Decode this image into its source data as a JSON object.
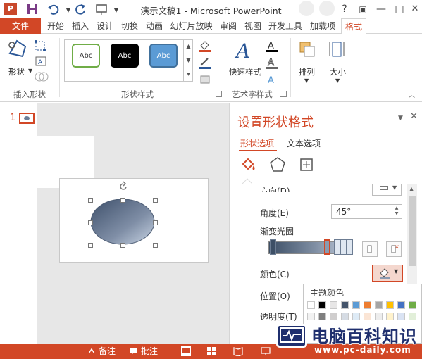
{
  "app": {
    "title": "演示文稿1 - Microsoft PowerPoint",
    "logo_letter": "P"
  },
  "win_controls": {
    "help": "?",
    "restore": "▣",
    "minimize": "—",
    "maximize": "□"
  },
  "tabs": {
    "file": "文件",
    "items": [
      "开始",
      "插入",
      "设计",
      "切换",
      "动画",
      "幻灯片放映",
      "审阅",
      "视图",
      "开发工具",
      "加载项"
    ],
    "active": "格式"
  },
  "ribbon": {
    "insert_shape": {
      "shape_label": "形状",
      "group_label": "插入形状"
    },
    "shape_styles": {
      "group_label": "形状样式",
      "presets": [
        {
          "label": "Abc",
          "fill": "#ffffff",
          "border": "#70ad47",
          "text": "#333333"
        },
        {
          "label": "Abc",
          "fill": "#000000",
          "border": "#000000",
          "text": "#ffffff"
        },
        {
          "label": "Abc",
          "fill": "#5b9bd5",
          "border": "#41719c",
          "text": "#ffffff"
        }
      ]
    },
    "art_styles": {
      "quick_styles_label": "快速样式",
      "group_label": "艺术字样式"
    },
    "arrange": {
      "label": "排列"
    },
    "size": {
      "label": "大小"
    }
  },
  "slides": {
    "number": "1"
  },
  "format_pane": {
    "title": "设置形状格式",
    "tabs": {
      "shape_options": "形状选项",
      "text_options": "文本选项"
    },
    "direction_label": "方向(D)",
    "angle_label": "角度(E)",
    "angle_value": "45°",
    "gradient_stops_label": "渐变光圈",
    "color_label": "颜色(C)",
    "position_label": "位置(O)",
    "transparency_label": "透明度(T)"
  },
  "color_popup": {
    "title": "主题颜色",
    "theme_colors": [
      "#ffffff",
      "#000000",
      "#e7e6e6",
      "#44546a",
      "#5b9bd5",
      "#ed7d31",
      "#a5a5a5",
      "#ffc000",
      "#4472c4",
      "#70ad47"
    ],
    "tint_row": [
      "#f2f2f2",
      "#7f7f7f",
      "#d0cece",
      "#d6dce4",
      "#deebf6",
      "#fbe5d5",
      "#ededed",
      "#fff2cc",
      "#dae3f3",
      "#e2efd9"
    ]
  },
  "statusbar": {
    "notes": "备注",
    "comments": "批注"
  },
  "watermark": {
    "text": "电脑百科知识",
    "url": "www.pc-daily.com"
  }
}
